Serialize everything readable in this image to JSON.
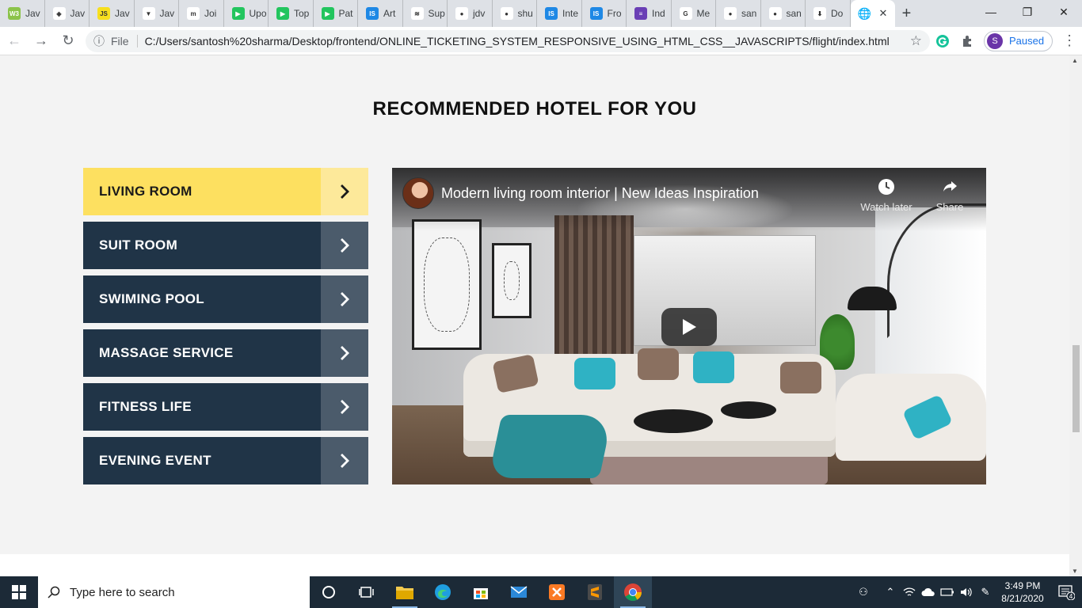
{
  "browser": {
    "tabs": [
      {
        "label": "Jav",
        "favicon_color": "#8bc34a",
        "favicon_glyph": "W3"
      },
      {
        "label": "Jav",
        "favicon_color": "#ffffff",
        "favicon_glyph": "◈"
      },
      {
        "label": "Jav",
        "favicon_color": "#f7df1e",
        "favicon_glyph": "JS"
      },
      {
        "label": "Jav",
        "favicon_color": "#ffffff",
        "favicon_glyph": "▼"
      },
      {
        "label": "Joi",
        "favicon_color": "#ffffff",
        "favicon_glyph": "m"
      },
      {
        "label": "Upo",
        "favicon_color": "#22c55e",
        "favicon_glyph": "▶"
      },
      {
        "label": "Top",
        "favicon_color": "#22c55e",
        "favicon_glyph": "▶"
      },
      {
        "label": "Pat",
        "favicon_color": "#22c55e",
        "favicon_glyph": "▶"
      },
      {
        "label": "Art",
        "favicon_color": "#1e88e5",
        "favicon_glyph": "IS"
      },
      {
        "label": "Sup",
        "favicon_color": "#ffffff",
        "favicon_glyph": "≋"
      },
      {
        "label": "jdv",
        "favicon_color": "#ffffff",
        "favicon_glyph": "●"
      },
      {
        "label": "shu",
        "favicon_color": "#ffffff",
        "favicon_glyph": "●"
      },
      {
        "label": "Inte",
        "favicon_color": "#1e88e5",
        "favicon_glyph": "IS"
      },
      {
        "label": "Fro",
        "favicon_color": "#1e88e5",
        "favicon_glyph": "IS"
      },
      {
        "label": "Ind",
        "favicon_color": "#6a3fb5",
        "favicon_glyph": "≡"
      },
      {
        "label": "Me",
        "favicon_color": "#ffffff",
        "favicon_glyph": "G"
      },
      {
        "label": "san",
        "favicon_color": "#ffffff",
        "favicon_glyph": "●"
      },
      {
        "label": "san",
        "favicon_color": "#ffffff",
        "favicon_glyph": "●"
      },
      {
        "label": "Do",
        "favicon_color": "#ffffff",
        "favicon_glyph": "⬇"
      }
    ],
    "active_tab_close": "✕",
    "new_tab": "+",
    "window_controls": {
      "minimize": "—",
      "restore": "❐",
      "close": "✕"
    },
    "nav": {
      "back": "←",
      "forward": "→",
      "reload": "↻"
    },
    "omnibox": {
      "info_icon": "ⓘ",
      "scheme_label": "File",
      "url": "C:/Users/santosh%20sharma/Desktop/frontend/ONLINE_TICKETING_SYSTEM_RESPONSIVE_USING_HTML_CSS__JAVASCRIPTS/flight/index.html",
      "star": "☆"
    },
    "profile": {
      "initial": "S",
      "status": "Paused"
    },
    "menu": "⋮"
  },
  "page": {
    "section_title": "RECOMMENDED HOTEL FOR YOU",
    "menu_items": [
      {
        "label": "LIVING ROOM",
        "active": true
      },
      {
        "label": "SUIT ROOM",
        "active": false
      },
      {
        "label": "SWIMING POOL",
        "active": false
      },
      {
        "label": "MASSAGE SERVICE",
        "active": false
      },
      {
        "label": "FITNESS LIFE",
        "active": false
      },
      {
        "label": "EVENING EVENT",
        "active": false
      }
    ],
    "video": {
      "title": "Modern living room interior | New Ideas Inspiration",
      "watch_later": "Watch later",
      "share": "Share"
    }
  },
  "taskbar": {
    "search_placeholder": "Type here to search",
    "time": "3:49 PM",
    "date": "8/21/2020",
    "notification_count": "4"
  }
}
